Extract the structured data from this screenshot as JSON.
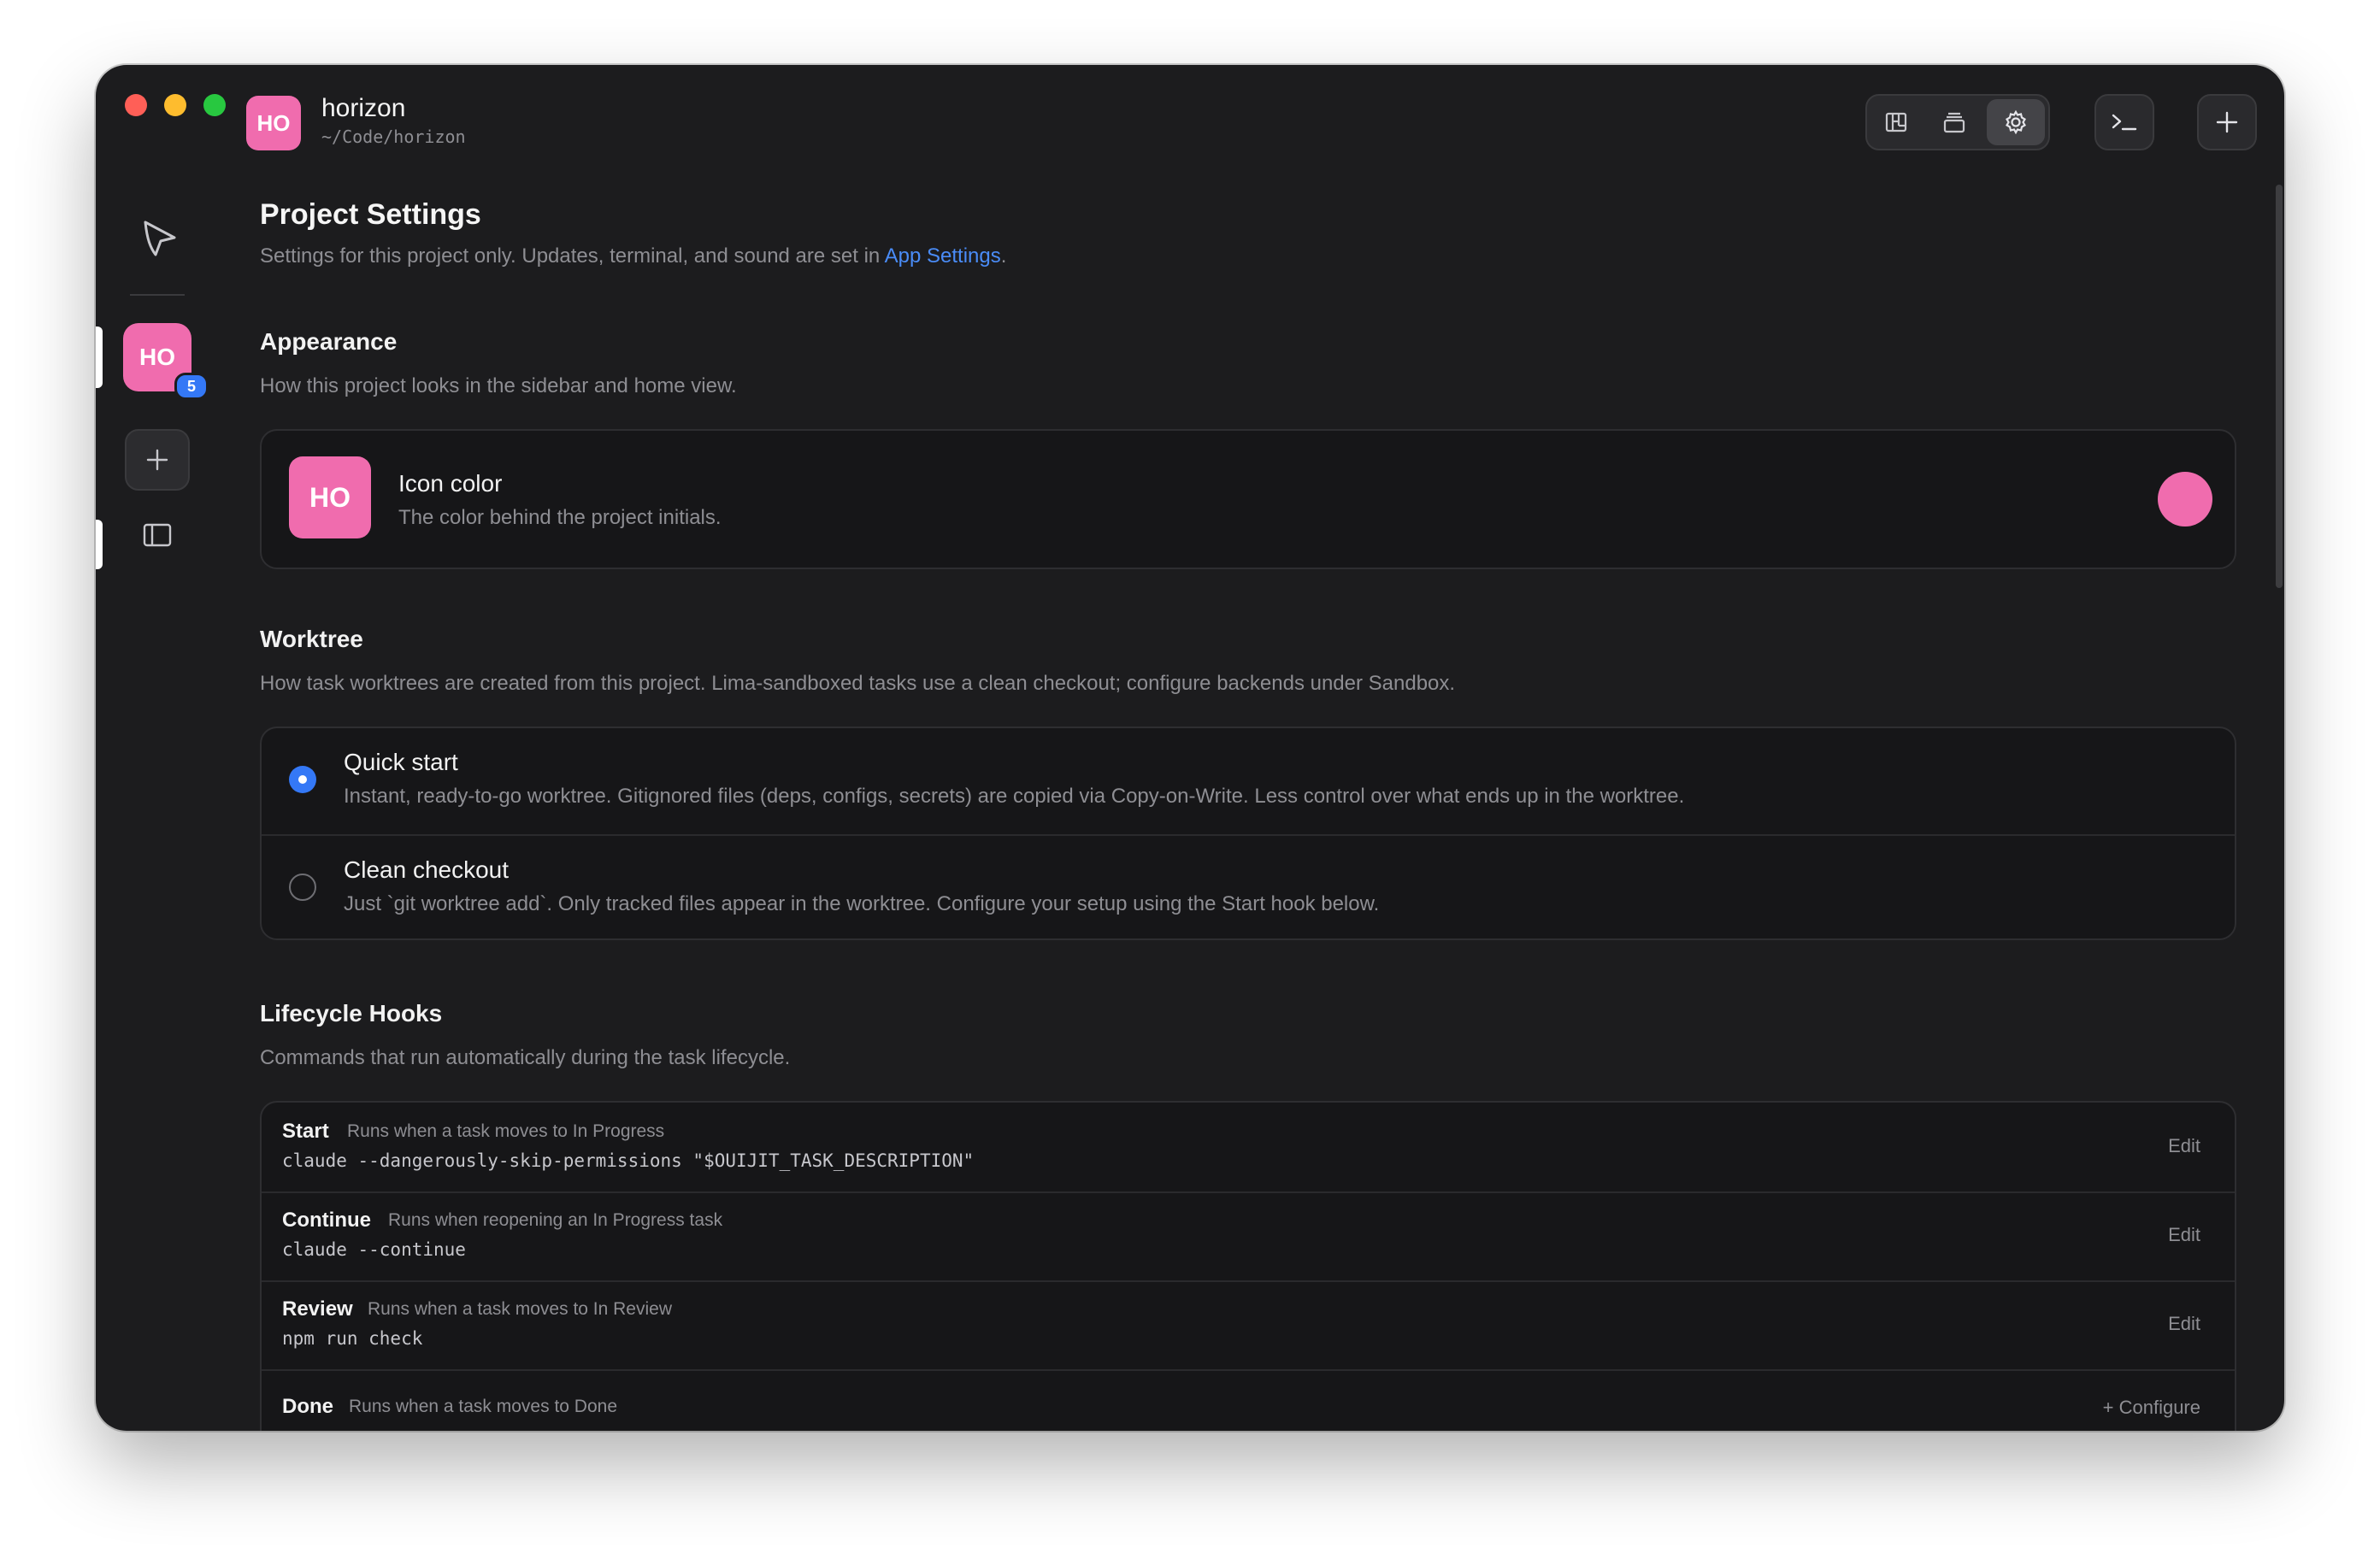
{
  "titlebar": {
    "project_initials": "HO",
    "project_name": "horizon",
    "project_path": "~/Code/horizon"
  },
  "toolbar": {
    "views": [
      {
        "icon": "board-view-icon",
        "active": false
      },
      {
        "icon": "stack-view-icon",
        "active": false
      },
      {
        "icon": "settings-gear-icon",
        "active": true
      }
    ],
    "terminal_icon": "terminal-icon",
    "new_icon": "plus-icon"
  },
  "sidebar": {
    "logo_icon": "app-logo-icon",
    "project_initials": "HO",
    "project_badge": "5",
    "add_icon": "plus-icon",
    "panel_icon": "sidebar-panel-icon"
  },
  "page": {
    "title": "Project Settings",
    "subtitle_prefix": "Settings for this project only. Updates, terminal, and sound are set in ",
    "subtitle_link": "App Settings",
    "subtitle_suffix": "."
  },
  "appearance": {
    "heading": "Appearance",
    "description": "How this project looks in the sidebar and home view.",
    "icon_initials": "HO",
    "icon_color_label": "Icon color",
    "icon_color_desc": "The color behind the project initials.",
    "color": "#f06cae"
  },
  "worktree": {
    "heading": "Worktree",
    "description": "How task worktrees are created from this project. Lima-sandboxed tasks use a clean checkout; configure backends under Sandbox.",
    "options": [
      {
        "title": "Quick start",
        "desc": "Instant, ready-to-go worktree. Gitignored files (deps, configs, secrets) are copied via Copy-on-Write. Less control over what ends up in the worktree.",
        "selected": true
      },
      {
        "title": "Clean checkout",
        "desc": "Just `git worktree add`. Only tracked files appear in the worktree. Configure your setup using the Start hook below.",
        "selected": false
      }
    ]
  },
  "hooks": {
    "heading": "Lifecycle Hooks",
    "description": "Commands that run automatically during the task lifecycle.",
    "items": [
      {
        "name": "Start",
        "desc": "Runs when a task moves to In Progress",
        "command": "claude --dangerously-skip-permissions \"$OUIJIT_TASK_DESCRIPTION\"",
        "action": "Edit"
      },
      {
        "name": "Continue",
        "desc": "Runs when reopening an In Progress task",
        "command": "claude --continue",
        "action": "Edit"
      },
      {
        "name": "Review",
        "desc": "Runs when a task moves to In Review",
        "command": "npm run check",
        "action": "Edit"
      },
      {
        "name": "Done",
        "desc": "Runs when a task moves to Done",
        "command": "",
        "action": "+ Configure"
      }
    ]
  },
  "colors": {
    "accent": "#3478f6",
    "project": "#f06cae",
    "background": "#1c1c1e"
  }
}
